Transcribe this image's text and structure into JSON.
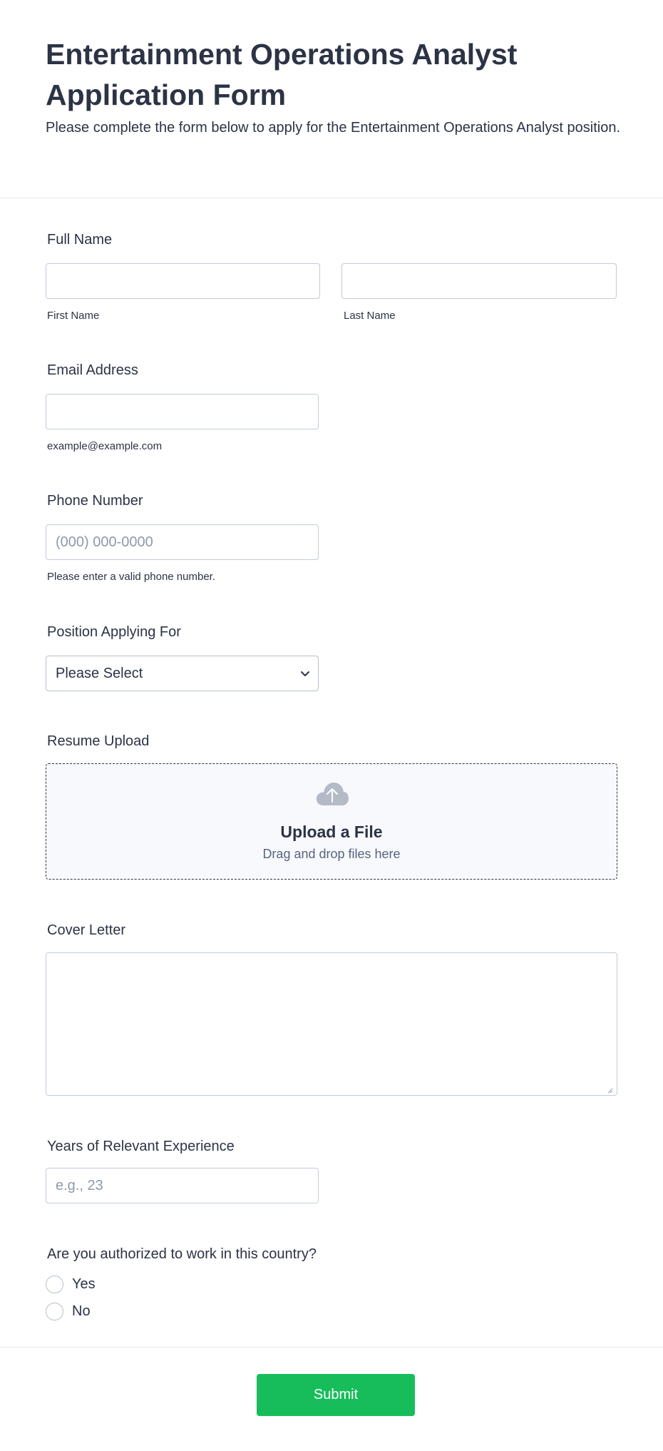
{
  "header": {
    "title": "Entertainment Operations Analyst Application Form",
    "subtitle": "Please complete the form below to apply for the Entertainment Operations Analyst position."
  },
  "full_name": {
    "label": "Full Name",
    "first_sublabel": "First Name",
    "last_sublabel": "Last Name",
    "first_value": "",
    "last_value": ""
  },
  "email": {
    "label": "Email Address",
    "sublabel": "example@example.com",
    "value": ""
  },
  "phone": {
    "label": "Phone Number",
    "placeholder": "(000) 000-0000",
    "sublabel": "Please enter a valid phone number.",
    "value": ""
  },
  "position": {
    "label": "Position Applying For",
    "selected": "Please Select",
    "icon": "chevron-down-icon"
  },
  "resume": {
    "label": "Resume Upload",
    "upload_title": "Upload a File",
    "upload_hint": "Drag and drop files here",
    "icon": "cloud-upload-icon"
  },
  "cover_letter": {
    "label": "Cover Letter",
    "value": ""
  },
  "experience": {
    "label": "Years of Relevant Experience",
    "placeholder": "e.g., 23",
    "value": ""
  },
  "authorization": {
    "label": "Are you authorized to work in this country?",
    "options": [
      "Yes",
      "No"
    ]
  },
  "submit": {
    "label": "Submit"
  },
  "colors": {
    "text": "#2c3345",
    "border": "#c3cad8",
    "submit": "#18bd5b",
    "upload_bg": "#f8f9fc",
    "placeholder": "#8f99aa"
  }
}
